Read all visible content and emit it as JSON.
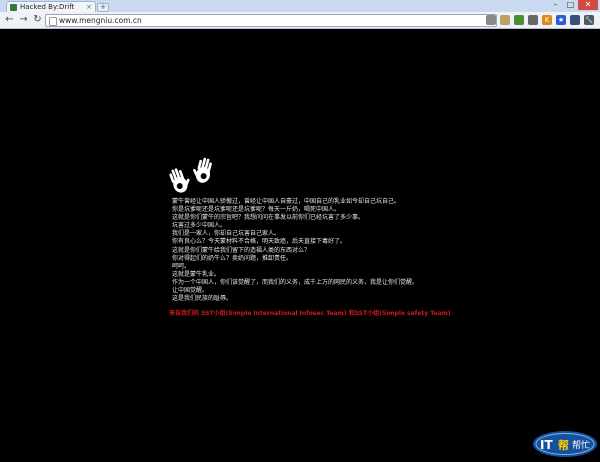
{
  "tab": {
    "title": "Hacked By:Drift",
    "close": "×"
  },
  "window": {
    "minimize": "–",
    "maximize": "□",
    "close": "✕"
  },
  "toolbar": {
    "back": "←",
    "forward": "→",
    "reload": "↻",
    "url": "www.mengniu.com.cn"
  },
  "extensions": [
    {
      "name": "ext-1",
      "color": "#888888",
      "glyph": ""
    },
    {
      "name": "ext-2",
      "color": "#c0a060",
      "glyph": ""
    },
    {
      "name": "ext-3",
      "color": "#4a8f2f",
      "glyph": ""
    },
    {
      "name": "ext-4",
      "color": "#666666",
      "glyph": ""
    },
    {
      "name": "ext-5",
      "color": "#e08a1c",
      "glyph": "K"
    },
    {
      "name": "ext-6",
      "color": "#2a5bd7",
      "glyph": "★"
    },
    {
      "name": "ext-7",
      "color": "#3b4f7a",
      "glyph": ""
    },
    {
      "name": "ext-8",
      "color": "#555555",
      "glyph": "🔧"
    }
  ],
  "message": {
    "lines": [
      "蒙牛曾经让中国人骄傲过，曾经让中国人自豪过，中国自己的乳业如今却自己坑自己。",
      "你是坑爹呢还是坑爹呢还是坑爹呢？每天一斤奶，喝死中国人。",
      "这就是你们蒙牛的宗旨吧？我想问问在事发以前你们已经坑害了多少事。",
      "坑害过多少中国人。",
      "我们是一家人，你却自己坑害自己家人。",
      "你有良心么？今天蒙材料不合格，明天致癌，后天直接下毒好了。",
      "这就是你们蒙牛给我们留下的造福人类的东西对么？",
      "你对得起们的奶牛么？卖奶问题，推卸责任。",
      "呵呵。",
      "这就是蒙牛乳业。",
      "作为一个中国人，你们该觉醒了，而我们的义务，成千上万的网民的义务，我是让你们觉醒。",
      "让中国觉醒。",
      "这是我们民族的耻辱。"
    ],
    "signature": "来自我们的 SST小组(Simple International Infosec Team) 和SST小组(Simple safety Team)"
  },
  "watermark": {
    "it": "IT",
    "bang": "帮",
    "help": "帮忙"
  }
}
